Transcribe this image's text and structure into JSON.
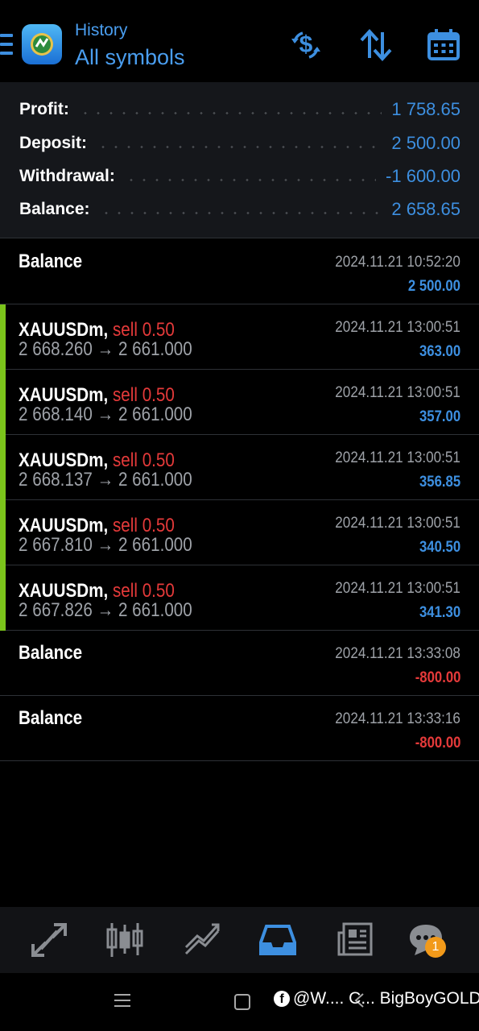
{
  "header": {
    "title_small": "History",
    "title_big": "All symbols",
    "icons": [
      "menu-icon",
      "app-logo",
      "deposit-withdraw-icon",
      "sort-icon",
      "calendar-icon"
    ],
    "accent_color": "#4a9ef0"
  },
  "summary": {
    "rows": [
      {
        "label": "Profit:",
        "value": "1 758.65"
      },
      {
        "label": "Deposit:",
        "value": "2 500.00"
      },
      {
        "label": "Withdrawal:",
        "value": "-1 600.00"
      },
      {
        "label": "Balance:",
        "value": "2 658.65"
      }
    ]
  },
  "list": [
    {
      "kind": "balance",
      "title": "Balance",
      "time": "2024.11.21 10:52:20",
      "amount": "2 500.00",
      "sign": "pos"
    },
    {
      "kind": "trade",
      "symbol": "XAUUSDm,",
      "side": "sell 0.50",
      "open": "2 668.260",
      "arrow": "→",
      "close": "2 661.000",
      "time": "2024.11.21 13:00:51",
      "amount": "363.00",
      "sign": "pos"
    },
    {
      "kind": "trade",
      "symbol": "XAUUSDm,",
      "side": "sell 0.50",
      "open": "2 668.140",
      "arrow": "→",
      "close": "2 661.000",
      "time": "2024.11.21 13:00:51",
      "amount": "357.00",
      "sign": "pos"
    },
    {
      "kind": "trade",
      "symbol": "XAUUSDm,",
      "side": "sell 0.50",
      "open": "2 668.137",
      "arrow": "→",
      "close": "2 661.000",
      "time": "2024.11.21 13:00:51",
      "amount": "356.85",
      "sign": "pos"
    },
    {
      "kind": "trade",
      "symbol": "XAUUSDm,",
      "side": "sell 0.50",
      "open": "2 667.810",
      "arrow": "→",
      "close": "2 661.000",
      "time": "2024.11.21 13:00:51",
      "amount": "340.50",
      "sign": "pos"
    },
    {
      "kind": "trade",
      "symbol": "XAUUSDm,",
      "side": "sell 0.50",
      "open": "2 667.826",
      "arrow": "→",
      "close": "2 661.000",
      "time": "2024.11.21 13:00:51",
      "amount": "341.30",
      "sign": "pos"
    },
    {
      "kind": "balance",
      "title": "Balance",
      "time": "2024.11.21 13:33:08",
      "amount": "-800.00",
      "sign": "neg"
    },
    {
      "kind": "balance",
      "title": "Balance",
      "time": "2024.11.21 13:33:16",
      "amount": "-800.00",
      "sign": "neg"
    }
  ],
  "colors": {
    "profit": "#3d8fe0",
    "loss": "#e53a3a",
    "sell": "#e53a3a",
    "trade_bar": "#7bc41b"
  },
  "bottom_nav": {
    "items": [
      "trade-icon",
      "quotes-icon",
      "chart-icon",
      "history-icon",
      "news-icon",
      "chat-icon"
    ],
    "active": "history-icon",
    "chat_badge": "1"
  },
  "system_bar": {
    "watermark_text": "@W.... C... BigBoyGOLD"
  }
}
